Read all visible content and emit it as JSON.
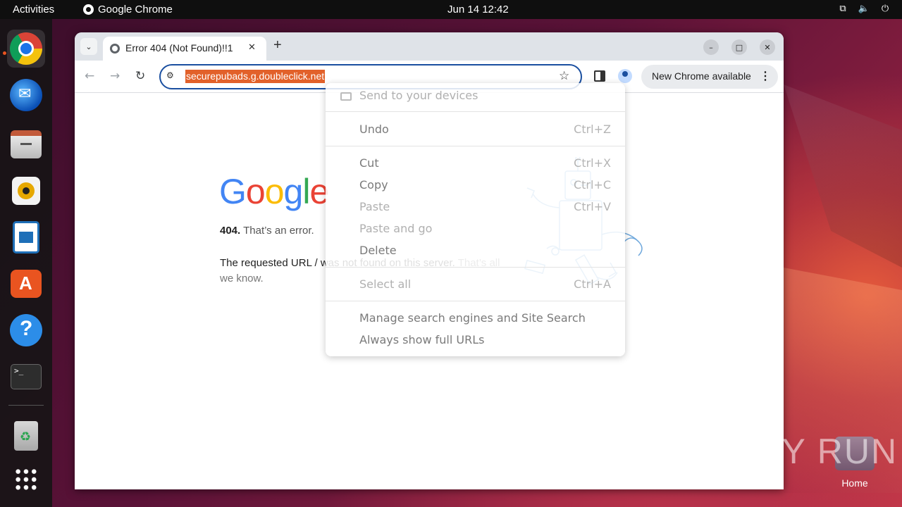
{
  "topbar": {
    "activities": "Activities",
    "app_name": "Google Chrome",
    "clock": "Jun 14  12:42"
  },
  "dock": {
    "items": [
      "chrome-icon",
      "thunderbird-icon",
      "files-icon",
      "rhythmbox-icon",
      "writer-icon",
      "app-center-icon",
      "help-icon",
      "terminal-icon",
      "trash-icon",
      "show-apps-icon"
    ]
  },
  "desktop": {
    "home_label": "Home",
    "watermark": "ANY RUN"
  },
  "browser": {
    "tab_title": "Error 404 (Not Found)!!1",
    "new_tab_symbol": "+",
    "url": "securepubads.g.doubleclick.net",
    "update_chip": "New Chrome available",
    "window_controls": [
      "minimize",
      "maximize",
      "close"
    ]
  },
  "page": {
    "logo_letters": [
      "G",
      "o",
      "o",
      "g",
      "l",
      "e"
    ],
    "error_code": "404.",
    "error_title": "That’s an error.",
    "error_message": "The requested URL / was not found on this server.",
    "error_tail": "That’s all we know."
  },
  "context_menu": {
    "items": [
      {
        "label": "Send to your devices",
        "shortcut": ""
      },
      {
        "label": "Undo",
        "shortcut": "Ctrl+Z"
      },
      {
        "label": "Cut",
        "shortcut": "Ctrl+X"
      },
      {
        "label": "Copy",
        "shortcut": "Ctrl+C"
      },
      {
        "label": "Paste",
        "shortcut": "Ctrl+V"
      },
      {
        "label": "Paste and go",
        "shortcut": ""
      },
      {
        "label": "Delete",
        "shortcut": ""
      },
      {
        "label": "Select all",
        "shortcut": "Ctrl+A"
      },
      {
        "label": "Manage search engines and Site Search",
        "shortcut": ""
      },
      {
        "label": "Always show full URLs",
        "shortcut": ""
      }
    ]
  },
  "colors": {
    "url_highlight": "#e2612a",
    "omnibox_focus": "#1a4fa0",
    "ubuntu_orange": "#e95420"
  }
}
